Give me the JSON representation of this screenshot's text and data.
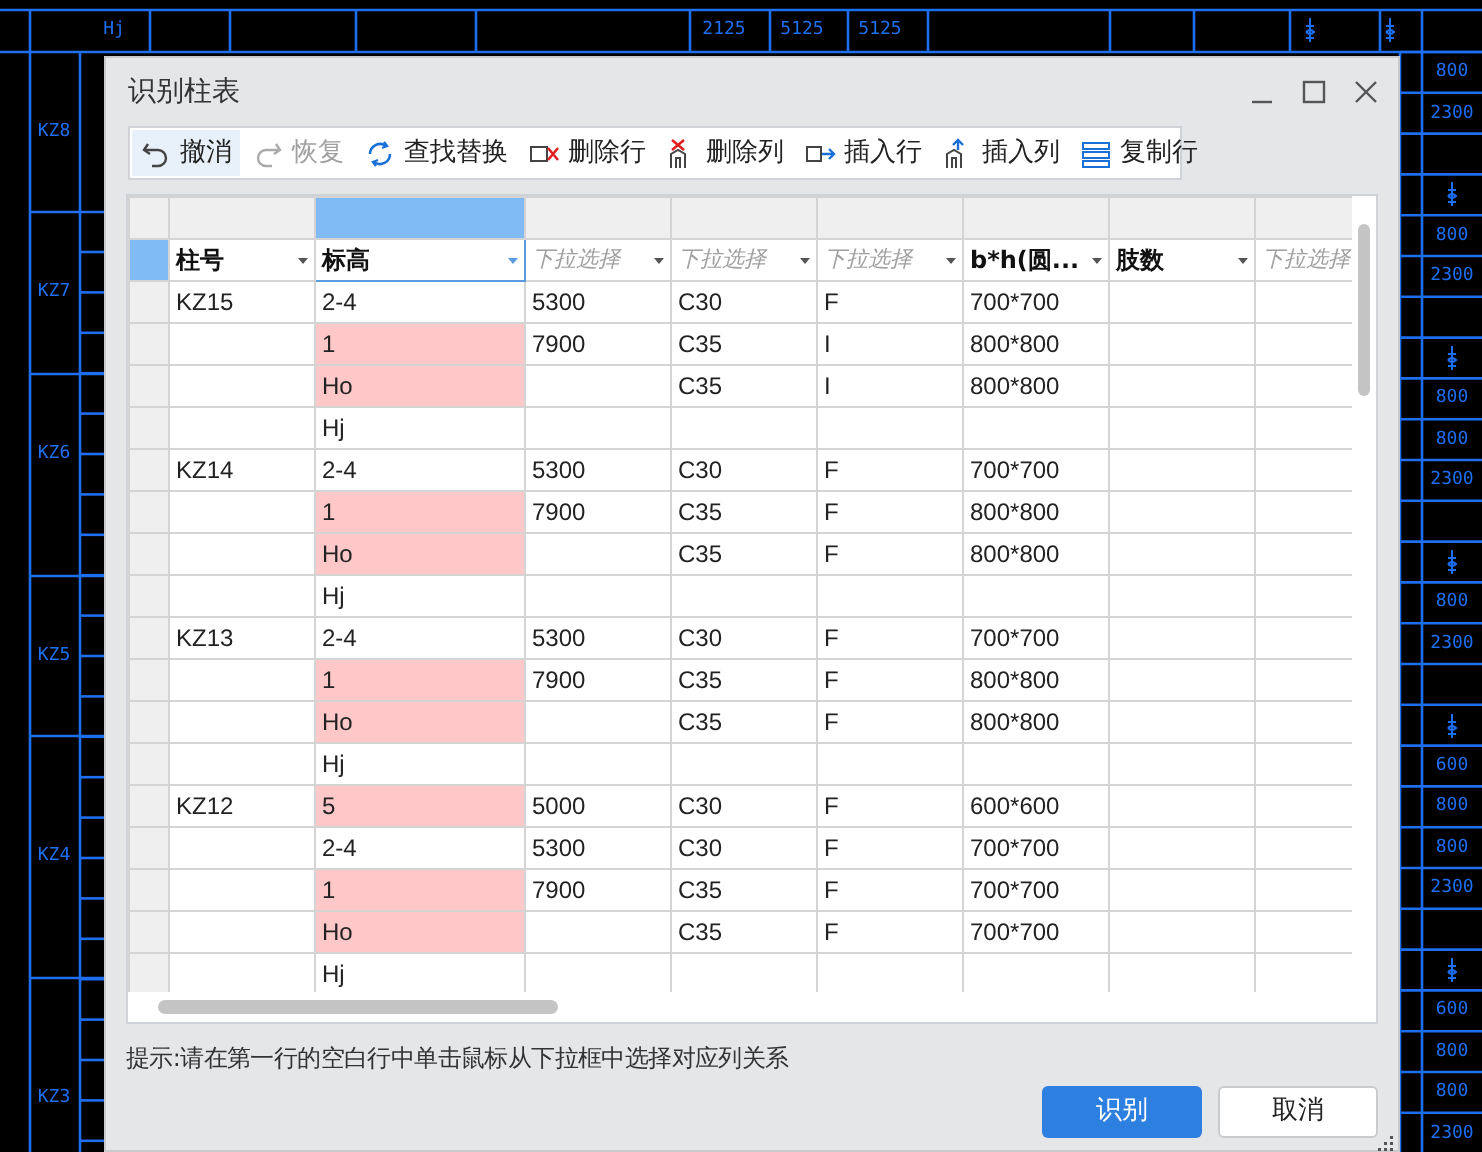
{
  "cad": {
    "top_labels": [
      "Hj",
      "2125",
      "5125",
      "5125"
    ],
    "left_labels": [
      "KZ8",
      "KZ7",
      "KZ6",
      "KZ5",
      "KZ4",
      "KZ3"
    ],
    "right_column": [
      {
        "kind": "text",
        "text": "800"
      },
      {
        "kind": "text",
        "text": "2300"
      },
      {
        "kind": "empty"
      },
      {
        "kind": "symbol"
      },
      {
        "kind": "text",
        "text": "800"
      },
      {
        "kind": "text",
        "text": "2300"
      },
      {
        "kind": "empty"
      },
      {
        "kind": "symbol"
      },
      {
        "kind": "text",
        "text": "800"
      },
      {
        "kind": "text",
        "text": "800"
      },
      {
        "kind": "text",
        "text": "2300"
      },
      {
        "kind": "empty"
      },
      {
        "kind": "symbol"
      },
      {
        "kind": "text",
        "text": "800"
      },
      {
        "kind": "text",
        "text": "2300"
      },
      {
        "kind": "empty"
      },
      {
        "kind": "symbol"
      },
      {
        "kind": "text",
        "text": "600"
      },
      {
        "kind": "text",
        "text": "800"
      },
      {
        "kind": "text",
        "text": "800"
      },
      {
        "kind": "text",
        "text": "2300"
      },
      {
        "kind": "empty"
      },
      {
        "kind": "symbol"
      },
      {
        "kind": "text",
        "text": "600"
      },
      {
        "kind": "text",
        "text": "800"
      },
      {
        "kind": "text",
        "text": "800"
      },
      {
        "kind": "text",
        "text": "2300"
      }
    ]
  },
  "window": {
    "title": "识别柱表"
  },
  "toolbar": [
    {
      "kind": "undo",
      "label": "撤消",
      "disabled": false,
      "hovered": true
    },
    {
      "kind": "redo",
      "label": "恢复",
      "disabled": true,
      "hovered": false
    },
    {
      "kind": "find_replace",
      "label": "查找替换",
      "disabled": false,
      "hovered": false
    },
    {
      "kind": "delete_row",
      "label": "删除行",
      "disabled": false,
      "hovered": false
    },
    {
      "kind": "delete_column",
      "label": "删除列",
      "disabled": false,
      "hovered": false
    },
    {
      "kind": "insert_row",
      "label": "插入行",
      "disabled": false,
      "hovered": false
    },
    {
      "kind": "insert_column",
      "label": "插入列",
      "disabled": false,
      "hovered": false
    },
    {
      "kind": "copy_row",
      "label": "复制行",
      "disabled": false,
      "hovered": false
    }
  ],
  "table": {
    "columns": [
      {
        "label": "柱号",
        "kind": "set",
        "selected": false
      },
      {
        "label": "标高",
        "kind": "set",
        "selected": true
      },
      {
        "label": "下拉选择",
        "kind": "placeholder",
        "selected": false
      },
      {
        "label": "下拉选择",
        "kind": "placeholder",
        "selected": false
      },
      {
        "label": "下拉选择",
        "kind": "placeholder",
        "selected": false
      },
      {
        "label": "b*h(圆...",
        "kind": "set",
        "selected": false
      },
      {
        "label": "肢数",
        "kind": "set",
        "selected": false
      },
      {
        "label": "下拉选择",
        "kind": "placeholder",
        "selected": false
      }
    ],
    "rows": [
      {
        "cells": [
          "KZ15",
          "2-4",
          "5300",
          "C30",
          "F",
          "700*700"
        ],
        "highlighted": false
      },
      {
        "cells": [
          null,
          "1",
          "7900",
          "C35",
          "I",
          "800*800"
        ],
        "highlighted": true
      },
      {
        "cells": [
          null,
          "Ho",
          null,
          "C35",
          "I",
          "800*800"
        ],
        "highlighted": true
      },
      {
        "cells": [
          null,
          "Hj"
        ],
        "highlighted": false
      },
      {
        "cells": [
          "KZ14",
          "2-4",
          "5300",
          "C30",
          "F",
          "700*700"
        ],
        "highlighted": false
      },
      {
        "cells": [
          null,
          "1",
          "7900",
          "C35",
          "F",
          "800*800"
        ],
        "highlighted": true
      },
      {
        "cells": [
          null,
          "Ho",
          null,
          "C35",
          "F",
          "800*800"
        ],
        "highlighted": true
      },
      {
        "cells": [
          null,
          "Hj"
        ],
        "highlighted": false
      },
      {
        "cells": [
          "KZ13",
          "2-4",
          "5300",
          "C30",
          "F",
          "700*700"
        ],
        "highlighted": false
      },
      {
        "cells": [
          null,
          "1",
          "7900",
          "C35",
          "F",
          "800*800"
        ],
        "highlighted": true
      },
      {
        "cells": [
          null,
          "Ho",
          null,
          "C35",
          "F",
          "800*800"
        ],
        "highlighted": true
      },
      {
        "cells": [
          null,
          "Hj"
        ],
        "highlighted": false
      },
      {
        "cells": [
          "KZ12",
          "5",
          "5000",
          "C30",
          "F",
          "600*600"
        ],
        "highlighted": true
      },
      {
        "cells": [
          null,
          "2-4",
          "5300",
          "C30",
          "F",
          "700*700"
        ],
        "highlighted": false
      },
      {
        "cells": [
          null,
          "1",
          "7900",
          "C35",
          "F",
          "700*700"
        ],
        "highlighted": true
      },
      {
        "cells": [
          null,
          "Ho",
          null,
          "C35",
          "F",
          "700*700"
        ],
        "highlighted": true
      },
      {
        "cells": [
          null,
          "Hj"
        ],
        "highlighted": false
      }
    ]
  },
  "hint": "提示:请在第一行的空白行中单击鼠标从下拉框中选择对应列关系",
  "buttons": [
    {
      "label": "识别",
      "primary": true
    },
    {
      "label": "取消",
      "primary": false
    }
  ]
}
